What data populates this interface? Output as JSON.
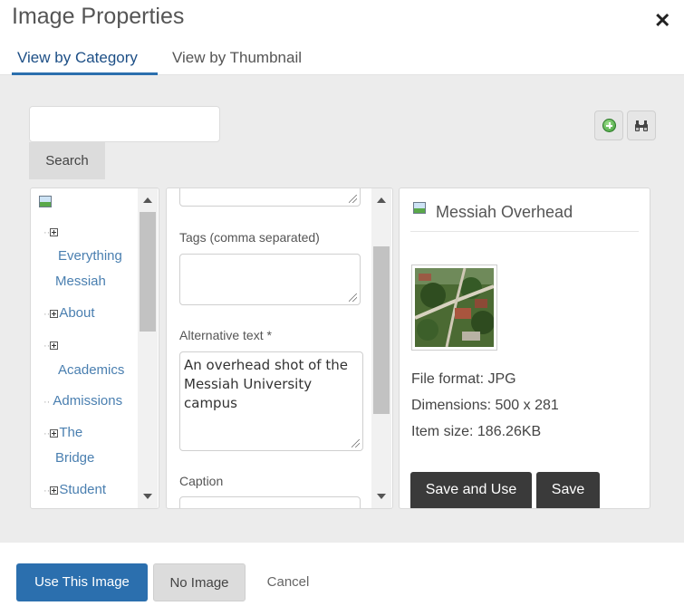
{
  "dialog": {
    "title": "Image Properties",
    "close_glyph": "✕"
  },
  "tabs": [
    {
      "label": "View by Category",
      "active": true
    },
    {
      "label": "View by Thumbnail",
      "active": false
    }
  ],
  "search": {
    "input_value": "",
    "button_label": "Search"
  },
  "toolbar": {
    "add_icon": "add-circle-icon",
    "binoculars_icon": "binoculars-icon"
  },
  "tree": {
    "root_icon": "image-folder-icon",
    "items": [
      {
        "label": "Everything Messiah",
        "line1": "Everything",
        "line2": "Messiah"
      },
      {
        "label": "About"
      },
      {
        "label": "Academics"
      },
      {
        "label": "Admissions"
      },
      {
        "label": "The Bridge",
        "line1": "The",
        "line2": "Bridge"
      },
      {
        "label": "Student"
      }
    ]
  },
  "form": {
    "tags_label": "Tags (comma separated)",
    "tags_value": "",
    "alt_label": "Alternative text *",
    "alt_value": "An overhead shot of the Messiah University campus",
    "caption_label": "Caption"
  },
  "details": {
    "name": "Messiah Overhead",
    "file_format": "File format: JPG",
    "dimensions": "Dimensions: 500 x 281",
    "item_size": "Item size: 186.26KB",
    "save_and_use_label": "Save and Use",
    "save_label": "Save"
  },
  "footer": {
    "use_label": "Use This Image",
    "no_image_label": "No Image",
    "cancel_label": "Cancel"
  },
  "colors": {
    "primary": "#2b6fae",
    "dark_button": "#3a3a3a",
    "tree_link": "#4a7fb0"
  }
}
